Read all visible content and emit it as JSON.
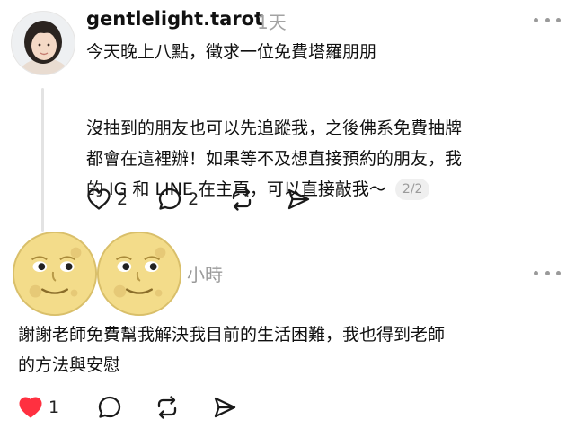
{
  "post": {
    "author": "gentlelight.tarot",
    "time": "1天",
    "text_line1": "今天晚上八點，徵求一位免費塔羅朋朋",
    "paragraph_lines": [
      "沒抽到的朋友也可以先追蹤我，之後佛系免費抽牌",
      "都會在這裡辦！如果等不及想直接預約的朋友，我",
      "的 IG 和 LINE 在主頁，可以直接敲我～"
    ],
    "page_indicator": "2/2",
    "like_count": "2",
    "comment_count": "2"
  },
  "reply": {
    "author": "小時",
    "text_lines": [
      "謝謝老師免費幫我解決我目前的生活困難，我也得到老師",
      "的方法與安慰"
    ],
    "like_count": "1",
    "liked": true
  },
  "colors": {
    "like_red": "#ff3040",
    "muted": "#9a9a9a",
    "thread_line": "#e3e3e3",
    "moon": "#f3dc8a"
  }
}
